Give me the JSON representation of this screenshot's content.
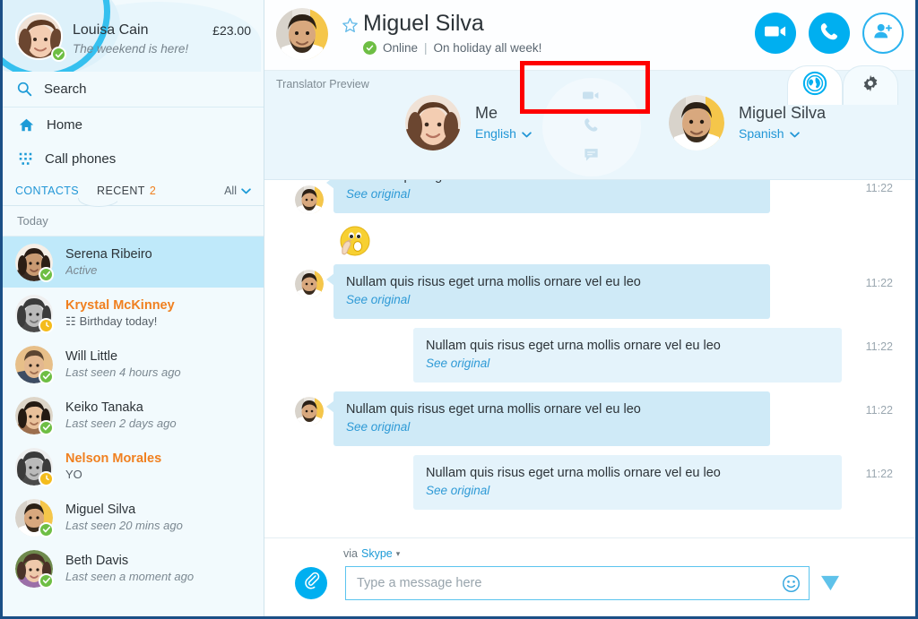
{
  "sidebar": {
    "profile": {
      "name": "Louisa Cain",
      "balance": "£23.00",
      "mood": "The weekend is here!",
      "status": "online",
      "avatar_name": "louisa-cain-avatar"
    },
    "search": {
      "label": "Search",
      "icon": "search-icon"
    },
    "nav": [
      {
        "label": "Home",
        "icon": "home-icon"
      },
      {
        "label": "Call phones",
        "icon": "dialpad-icon"
      }
    ],
    "tabs": {
      "contacts_label": "CONTACTS",
      "recent_label": "RECENT",
      "recent_badge": "2",
      "filter_label": "All",
      "filter_icon": "chevron-down-icon",
      "active": "RECENT"
    },
    "day_separator": "Today",
    "contacts": [
      {
        "name": "Serena Ribeiro",
        "sub": "Active",
        "status": "online",
        "selected": true,
        "highlight": false,
        "gray": false,
        "italic": true,
        "gift": false
      },
      {
        "name": "Krystal McKinney",
        "sub": "Birthday today!",
        "status": "away",
        "selected": false,
        "highlight": true,
        "gray": true,
        "italic": false,
        "gift": true
      },
      {
        "name": "Will Little",
        "sub": "Last seen 4 hours ago",
        "status": "online",
        "selected": false,
        "highlight": false,
        "gray": false,
        "italic": true,
        "gift": false
      },
      {
        "name": "Keiko Tanaka",
        "sub": "Last seen 2 days ago",
        "status": "online",
        "selected": false,
        "highlight": false,
        "gray": false,
        "italic": true,
        "gift": false
      },
      {
        "name": "Nelson Morales",
        "sub": "YO",
        "status": "away",
        "selected": false,
        "highlight": true,
        "gray": true,
        "italic": false,
        "gift": false
      },
      {
        "name": "Miguel Silva",
        "sub": "Last seen 20 mins ago",
        "status": "online",
        "selected": false,
        "highlight": false,
        "gray": false,
        "italic": true,
        "gift": false
      },
      {
        "name": "Beth Davis",
        "sub": "Last seen a moment ago",
        "status": "online",
        "selected": false,
        "highlight": false,
        "gray": false,
        "italic": true,
        "gift": false
      }
    ]
  },
  "header": {
    "contact_name": "Miguel Silva",
    "star_icon": "favorite-star-icon",
    "status_text": "Online",
    "divider": "|",
    "mood_text": "On holiday all week!",
    "actions": [
      {
        "name": "video-call-button",
        "icon": "video-camera-icon"
      },
      {
        "name": "voice-call-button",
        "icon": "phone-icon"
      },
      {
        "name": "add-people-button",
        "icon": "add-person-icon"
      }
    ],
    "tray_tabs": [
      {
        "name": "translator-tab",
        "icon": "globe-translator-icon",
        "selected": true
      },
      {
        "name": "settings-tab",
        "icon": "gear-icon",
        "selected": false
      }
    ],
    "highlight_color": "#fe0000"
  },
  "translator": {
    "label": "Translator Preview",
    "center_icons": [
      "video-camera-icon",
      "phone-icon",
      "chat-bubble-icon"
    ],
    "left": {
      "name": "Me",
      "language": "English",
      "caret_icon": "chevron-down-icon",
      "avatar_name": "me-avatar"
    },
    "right": {
      "name": "Miguel Silva",
      "language": "Spanish",
      "caret_icon": "chevron-down-icon",
      "avatar_name": "miguel-silva-avatar"
    }
  },
  "messages": [
    {
      "type": "text",
      "direction": "in",
      "clipped": true,
      "text": "Pellentesque Ligus Risus",
      "see_original": "See original",
      "time": "11:22"
    },
    {
      "type": "emoji",
      "direction": "in",
      "emoji_name": "shush-face-emoji"
    },
    {
      "type": "text",
      "direction": "in",
      "clipped": false,
      "text": "Nullam quis risus eget urna mollis ornare vel eu leo",
      "see_original": "See original",
      "time": "11:22"
    },
    {
      "type": "text",
      "direction": "out",
      "clipped": false,
      "text": "Nullam quis risus eget urna mollis ornare vel eu leo",
      "see_original": "See original",
      "time": "11:22"
    },
    {
      "type": "text",
      "direction": "in",
      "clipped": false,
      "text": "Nullam quis risus eget urna mollis ornare vel eu leo",
      "see_original": "See original",
      "time": "11:22"
    },
    {
      "type": "text",
      "direction": "out",
      "clipped": false,
      "text": "Nullam quis risus eget urna mollis ornare vel eu leo",
      "see_original": "See original",
      "time": "11:22"
    }
  ],
  "compose": {
    "via_prefix": "via",
    "via_service": "Skype",
    "via_caret": "▾",
    "attach_icon": "paperclip-icon",
    "placeholder": "Type a message here",
    "value": "",
    "emoji_icon": "smiley-icon",
    "send_icon": "send-paper-plane-icon"
  },
  "colors": {
    "accent": "#00aff0",
    "link": "#2196d6",
    "online": "#6ebe44",
    "away": "#f4bc1c",
    "highlight_name": "#f08020",
    "bubble_in": "#cfeaf7",
    "bubble_out": "#e4f3fb",
    "selected_row": "#bfe9fa",
    "red_highlight": "#fe0000"
  }
}
